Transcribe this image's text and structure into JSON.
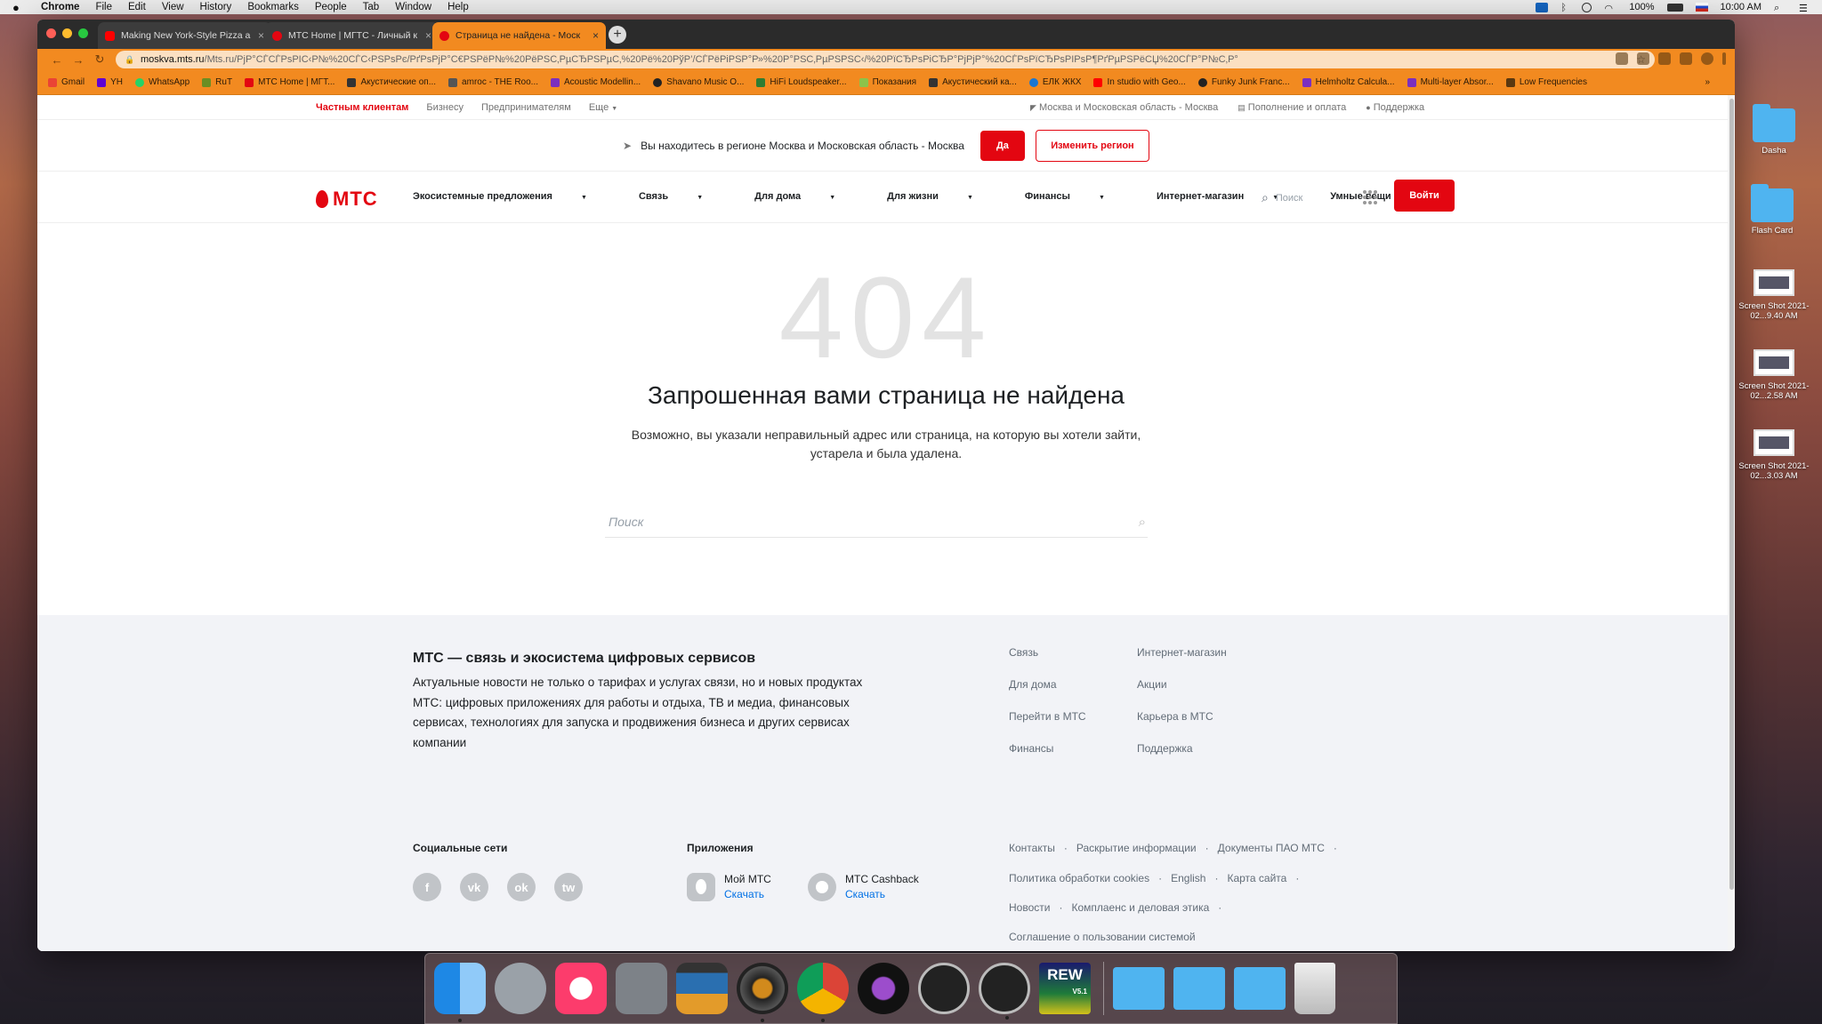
{
  "menubar": {
    "app": "Chrome",
    "items": [
      "File",
      "Edit",
      "View",
      "History",
      "Bookmarks",
      "People",
      "Tab",
      "Window",
      "Help"
    ],
    "battery": "100%",
    "time": "10:00 AM"
  },
  "tabs": [
    {
      "title": "Making New York-Style Pizza a",
      "color": "#ff0000"
    },
    {
      "title": "МТС Home | МГТС - Личный к",
      "color": "#e30611"
    },
    {
      "title": "Страница не найдена - Моск",
      "color": "#e30611"
    }
  ],
  "address": {
    "domain": "moskva.mts.ru",
    "path": "/Mts.ru/РјР°СЃСЃРѕРІС‹Р№%20СЃС‹РЅРѕРє/РґРѕРјР°С€РЅРёР№%20РёРЅС‚РµСЂРЅРµС‚%20Рё%20РўР’/СЃРёРіРЅР°Р»%20Р°РЅС‚РµРЅРЅС‹/%20РїСЂРѕРіСЂР°РјРјР°%20СЃРѕРїСЂРѕРІРѕР¶РґРµРЅРёСЏ%20СЃР°Р№С‚Р°"
  },
  "bookmarks": [
    "Gmail",
    "YH",
    "WhatsApp",
    "RuT",
    "МТС Home | МГТ...",
    "Акустические оп...",
    "amroc - THE Roo...",
    "Acoustic Modellin...",
    "Shavano Music O...",
    "HiFi Loudspeaker...",
    "Показания",
    "Акустический ка...",
    "ЕЛК ЖКХ",
    "In studio with Geo...",
    "Funky Junk Franc...",
    "Helmholtz Calcula...",
    "Multi-layer Absor...",
    "Low Frequencies"
  ],
  "bookmarks_more": "»",
  "topnav": {
    "left": [
      "Частным клиентам",
      "Бизнесу",
      "Предпринимателям",
      "Еще"
    ],
    "right": [
      "Москва и Московская область - Москва",
      "Пополнение и оплата",
      "Поддержка"
    ]
  },
  "region": {
    "text": "Вы находитесь в регионе Москва и Московская область - Москва",
    "yes": "Да",
    "change": "Изменить регион"
  },
  "mainnav": {
    "logo": "МТС",
    "items": [
      "Экосистемные предложения",
      "Связь",
      "Для дома",
      "Для жизни",
      "Финансы",
      "Интернет-магазин",
      "Умные вещи"
    ],
    "search": "Поиск",
    "login": "Войти"
  },
  "error": {
    "code": "404",
    "title": "Запрошенная вами страница не найдена",
    "line1": "Возможно, вы указали неправильный адрес или страница, на которую вы хотели зайти,",
    "line2": "устарела и была удалена.",
    "search_placeholder": "Поиск"
  },
  "footer": {
    "title": "МТС — связь и экосистема цифровых сервисов",
    "desc": "Актуальные новости не только о тарифах и услугах связи, но и новых продуктах МТС: цифровых приложениях для работы и отдыха, ТВ и медиа, финансовых сервисах, технологиях для запуска и продвижения бизнеса и других сервисах компании",
    "links_col1": [
      "Связь",
      "Для дома",
      "Перейти в МТС",
      "Финансы"
    ],
    "links_col2": [
      "Интернет-магазин",
      "Акции",
      "Карьера в МТС",
      "Поддержка"
    ],
    "social_title": "Социальные сети",
    "social": [
      "f",
      "vk",
      "ok",
      "tw"
    ],
    "apps_title": "Приложения",
    "apps": [
      {
        "name": "Мой МТС",
        "action": "Скачать"
      },
      {
        "name": "МТС Cashback",
        "action": "Скачать"
      }
    ],
    "legal_row1": [
      "Контакты",
      "Раскрытие информации",
      "Документы ПАО МТС"
    ],
    "legal_row2": [
      "Политика обработки cookies",
      "English",
      "Карта сайта"
    ],
    "legal_row3": [
      "Новости",
      "Комплаенс и деловая этика"
    ],
    "legal_row4": "Соглашение о пользовании системой"
  },
  "desktop": [
    {
      "label": "Dasha",
      "type": "folder"
    },
    {
      "label": "Flash Card",
      "type": "folder"
    },
    {
      "label": "Screen Shot 2021-02...9.40 AM",
      "type": "shot"
    },
    {
      "label": "Screen Shot 2021-02...2.58 AM",
      "type": "shot"
    },
    {
      "label": "Screen Shot 2021-02...3.03 AM",
      "type": "shot"
    }
  ],
  "dock_rew_label": "REW",
  "dock_rew_version": "V5.1",
  "colors": {
    "brand": "#e30611",
    "chrome_accent": "#f28a20"
  }
}
